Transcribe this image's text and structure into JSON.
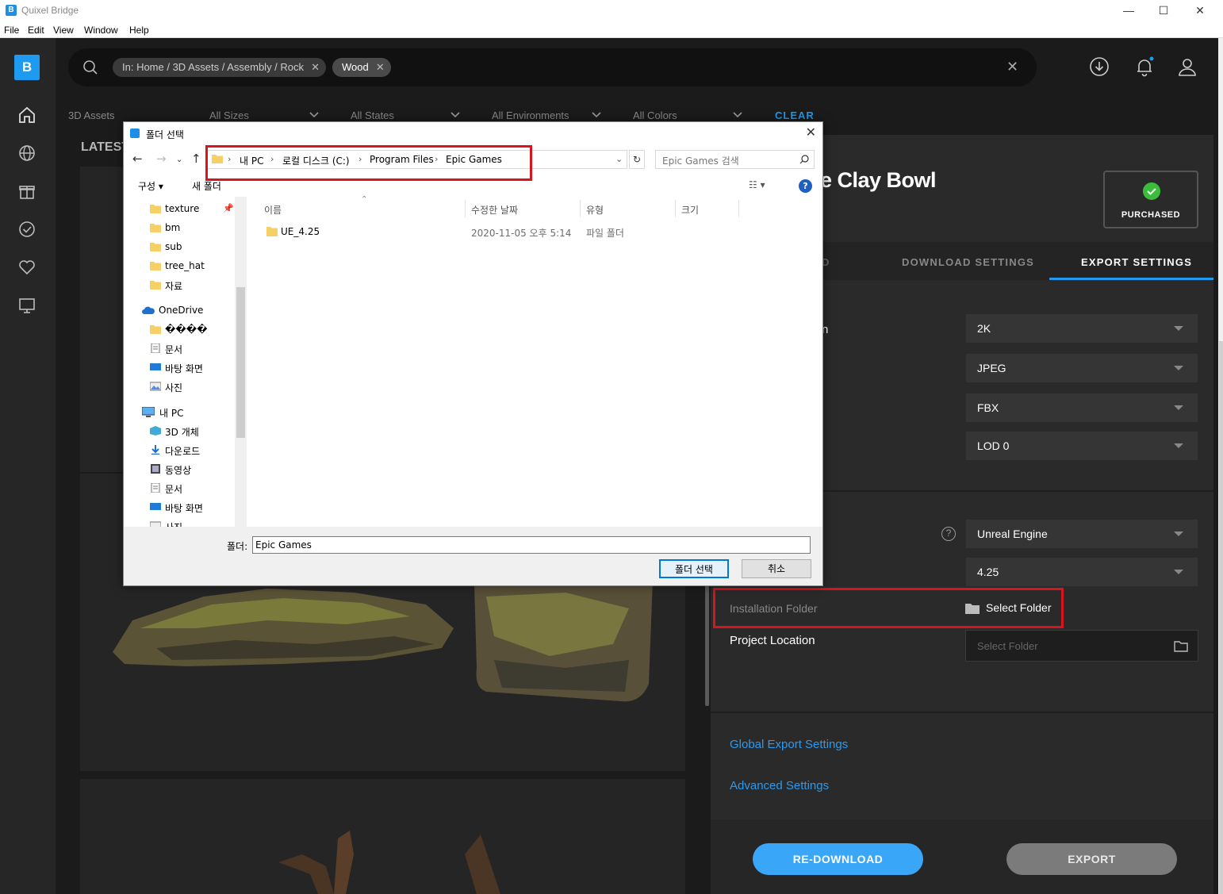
{
  "window": {
    "title": "Quixel Bridge",
    "controls": [
      "—",
      "☐",
      "✕"
    ]
  },
  "menu": [
    "File",
    "Edit",
    "View",
    "Window",
    "Help"
  ],
  "search": {
    "chips": [
      {
        "label": "In: Home / 3D Assets / Assembly / Rock"
      },
      {
        "label": "Wood"
      }
    ],
    "clear_glyph": "✕"
  },
  "filters": {
    "items": [
      "3D Assets",
      "All Sizes",
      "All States",
      "All Environments",
      "All Colors"
    ],
    "clear_label": "CLEAR"
  },
  "content": {
    "section_title": "LATEST"
  },
  "asset": {
    "title": "e Clay Bowl",
    "purchased_label": "PURCHASED",
    "tabs": [
      "D",
      "DOWNLOAD SETTINGS",
      "EXPORT SETTINGS"
    ],
    "partial_label": "n",
    "export_selects": [
      "2K",
      "JPEG",
      "FBX",
      "LOD 0"
    ],
    "engine_selects": [
      "Unreal Engine",
      "4.25"
    ],
    "help_glyph": "?",
    "installation_folder_label": "Installation Folder",
    "select_folder_label": "Select Folder",
    "project_location_label": "Project Location",
    "project_placeholder": "Select Folder",
    "links": [
      "Global Export Settings",
      "Advanced Settings"
    ],
    "redownload_label": "RE-DOWNLOAD",
    "export_label": "EXPORT"
  },
  "dialog": {
    "title": "폴더 선택",
    "close_glyph": "✕",
    "breadcrumb": [
      "내 PC",
      "로컬 디스크 (C:)",
      "Program Files",
      "Epic Games"
    ],
    "search_placeholder": "Epic Games 검색",
    "organize_label": "구성 ▾",
    "new_folder_label": "새 폴더",
    "tree": [
      {
        "label": "texture",
        "icon": "folder",
        "pinned": true
      },
      {
        "label": "bm",
        "icon": "folder"
      },
      {
        "label": "sub",
        "icon": "folder"
      },
      {
        "label": "tree_hat",
        "icon": "folder"
      },
      {
        "label": "자료",
        "icon": "folder"
      },
      {
        "label": "OneDrive",
        "icon": "cloud"
      },
      {
        "label": "����",
        "icon": "folder"
      },
      {
        "label": "문서",
        "icon": "document"
      },
      {
        "label": "바탕 화면",
        "icon": "desktop"
      },
      {
        "label": "사진",
        "icon": "pictures"
      },
      {
        "label": "내 PC",
        "icon": "computer"
      },
      {
        "label": "3D 개체",
        "icon": "3d-objects"
      },
      {
        "label": "다운로드",
        "icon": "download"
      },
      {
        "label": "동영상",
        "icon": "video"
      },
      {
        "label": "문서",
        "icon": "document"
      },
      {
        "label": "바탕 화면",
        "icon": "desktop"
      },
      {
        "label": "사진",
        "icon": "pictures"
      }
    ],
    "columns": [
      "이름",
      "수정한 날짜",
      "유형",
      "크기"
    ],
    "files": [
      {
        "name": "UE_4.25",
        "modified": "2020-11-05 오후 5:14",
        "type": "파일 폴더",
        "size": ""
      }
    ],
    "folder_label": "폴더:",
    "folder_value": "Epic Games",
    "select_button": "폴더 선택",
    "cancel_button": "취소"
  },
  "colors": {
    "accent": "#1e9bf0",
    "highlight": "#d8141c",
    "panel": "#2a2a2a",
    "background": "#1b1b1b"
  }
}
